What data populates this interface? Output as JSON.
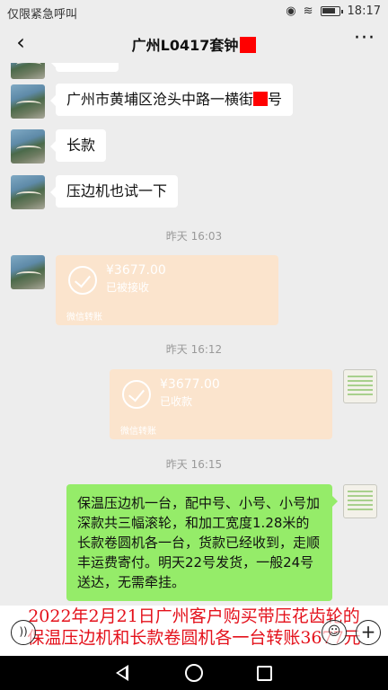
{
  "status_bar": {
    "carrier": "仅限紧急呼叫",
    "time": "18:17"
  },
  "header": {
    "title": "广州L0417套钟"
  },
  "messages": [
    {
      "text": "广州市黄埔区沧头中路一横街",
      "suffix": "号"
    },
    {
      "text": "长款"
    },
    {
      "text": "压边机也试一下"
    }
  ],
  "timestamps": [
    "昨天 16:03",
    "昨天 16:12",
    "昨天 16:15"
  ],
  "transfers": [
    {
      "amount": "¥3677.00",
      "status": "已被接收",
      "source": "微信转账"
    },
    {
      "amount": "¥3677.00",
      "status": "已收款",
      "source": "微信转账"
    }
  ],
  "outgoing_message": "保温压边机一台，配中号、小号、小号加深款共三幅滚轮，和加工宽度1.28米的长款卷圆机各一台，货款已经收到，走顺丰运费寄付。明天22号发货，一般24号送达，无需牵挂。",
  "caption": {
    "line1": "2022年2月21日广州客户购买带压花齿轮的",
    "line2": "保温压边机和长款卷圆机各一台转账3677元"
  },
  "icons": {
    "back": "back-arrow-icon",
    "more": "more-dots-icon",
    "voice": "voice-icon",
    "emoji": "emoji-icon",
    "plus": "plus-icon"
  }
}
